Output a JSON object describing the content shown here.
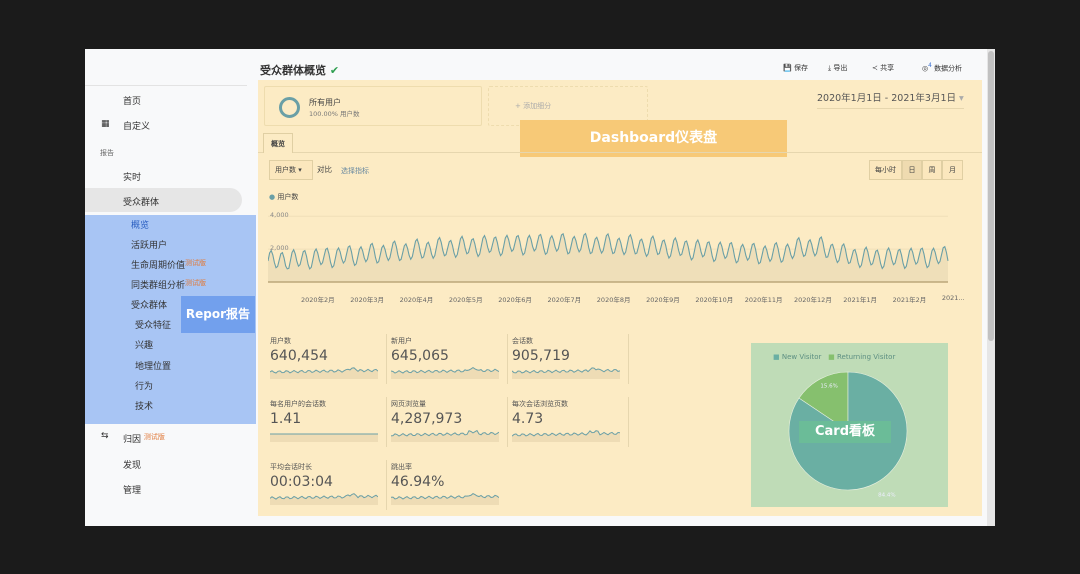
{
  "sidebar": {
    "items": [
      {
        "label": "首页"
      },
      {
        "label": "自定义"
      },
      {
        "label": "报告"
      },
      {
        "label": "实时"
      },
      {
        "label": "受众群体"
      },
      {
        "label": "概览"
      },
      {
        "label": "活跃用户"
      },
      {
        "label": "生命周期价值"
      },
      {
        "label": "同类群组分析"
      },
      {
        "label": "受众群体"
      },
      {
        "label": "受众特征"
      },
      {
        "label": "兴趣"
      },
      {
        "label": "地理位置"
      },
      {
        "label": "行为"
      },
      {
        "label": "技术"
      },
      {
        "label": "归因"
      },
      {
        "label": "发现"
      },
      {
        "label": "管理"
      }
    ],
    "beta": "测试版",
    "overlay_label": "Repor报告"
  },
  "header": {
    "title": "受众群体概览",
    "save": "保存",
    "export": "导出",
    "share": "共享",
    "insights": "数据分析",
    "insights_badge": "4"
  },
  "segments": {
    "all_users": "所有用户",
    "all_users_sub": "100.00% 用户数",
    "add": "+ 添加细分"
  },
  "overlay_label": "Dashboard仪表盘",
  "date_range": "2020年1月1日 - 2021年3月1日",
  "tab": "概览",
  "controls": {
    "metric": "用户数",
    "vs": "对比",
    "select_metric": "选择指标",
    "granularity": [
      "每小时",
      "日",
      "周",
      "月"
    ],
    "active": "日"
  },
  "chart_data": [
    {
      "type": "line",
      "series": [
        {
          "name": "用户数",
          "color": "#6a9fa6"
        }
      ],
      "yticks": [
        "4,000",
        "2,000"
      ],
      "ylim": [
        0,
        4500
      ],
      "xticks": [
        "2020年2月",
        "2020年3月",
        "2020年4月",
        "2020年5月",
        "2020年6月",
        "2020年7月",
        "2020年8月",
        "2020年9月",
        "2020年10月",
        "2020年11月",
        "2020年12月",
        "2021年1月",
        "2021年2月",
        "2021..."
      ]
    },
    {
      "type": "pie",
      "legend": [
        "New Visitor",
        "Returning Visitor"
      ],
      "values": [
        84.4,
        15.6
      ],
      "labels": [
        "84.4%",
        "15.6%"
      ],
      "colors": [
        "#6aafa3",
        "#86c06e"
      ],
      "legend_placement": "top"
    }
  ],
  "kpis": [
    {
      "label": "用户数",
      "value": "640,454"
    },
    {
      "label": "新用户",
      "value": "645,065"
    },
    {
      "label": "会话数",
      "value": "905,719"
    },
    {
      "label": "每名用户的会话数",
      "value": "1.41"
    },
    {
      "label": "网页浏览量",
      "value": "4,287,973"
    },
    {
      "label": "每次会话浏览页数",
      "value": "4.73"
    },
    {
      "label": "平均会话时长",
      "value": "00:03:04"
    },
    {
      "label": "跳出率",
      "value": "46.94%"
    }
  ],
  "card_label": "Card看板"
}
